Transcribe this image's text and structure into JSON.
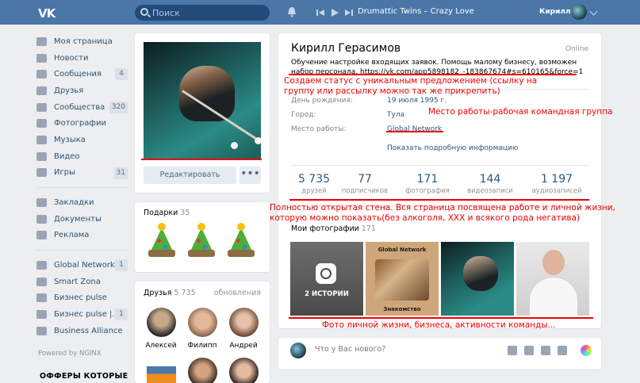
{
  "topbar": {
    "logo": "VK",
    "search_placeholder": "Поиск",
    "track": "Drumattic Twins – Crazy Love",
    "user_name": "Кирилл"
  },
  "menu": {
    "items": [
      {
        "label": "Моя страница",
        "count": "",
        "icon": "home-icon"
      },
      {
        "label": "Новости",
        "count": "",
        "icon": "news-icon"
      },
      {
        "label": "Сообщения",
        "count": "4",
        "icon": "messages-icon"
      },
      {
        "label": "Друзья",
        "count": "",
        "icon": "friends-icon"
      },
      {
        "label": "Сообщества",
        "count": "320",
        "icon": "communities-icon"
      },
      {
        "label": "Фотографии",
        "count": "",
        "icon": "photos-icon"
      },
      {
        "label": "Музыка",
        "count": "",
        "icon": "music-icon"
      },
      {
        "label": "Видео",
        "count": "",
        "icon": "video-icon"
      },
      {
        "label": "Игры",
        "count": "31",
        "icon": "games-icon"
      }
    ],
    "items2": [
      {
        "label": "Закладки",
        "icon": "bookmarks-icon"
      },
      {
        "label": "Документы",
        "icon": "documents-icon"
      },
      {
        "label": "Реклама",
        "icon": "ads-icon"
      }
    ],
    "items3": [
      {
        "label": "Global Network",
        "count": "1"
      },
      {
        "label": "Smart Zona",
        "count": ""
      },
      {
        "label": "Бизнес pulse",
        "count": ""
      },
      {
        "label": "Бизнес pulse |..",
        "count": "1"
      },
      {
        "label": "Business Alliance",
        "count": ""
      }
    ],
    "powered": "Powered by NGINX",
    "offers": "ОФФЕРЫ КОТОРЫЕ"
  },
  "profile_card": {
    "edit_label": "Редактировать",
    "more_label": "•••"
  },
  "gifts": {
    "title": "Подарки",
    "count": "35"
  },
  "friends": {
    "title": "Друзья",
    "count": "5 735",
    "updates": "обновления",
    "list": [
      {
        "name": "Алексей"
      },
      {
        "name": "Филипп"
      },
      {
        "name": "Андрей"
      }
    ]
  },
  "profile": {
    "name": "Кирилл Герасимов",
    "online": "Online",
    "status": "Обучение настройке входящих заявок. Помощь малому бизнесу, возможен набор персонала. https://vk.com/app5898182_-183867674#s=610165&force=1",
    "rows": [
      {
        "label": "День рождения:",
        "value": "19 июля 1995 г."
      },
      {
        "label": "Город:",
        "value": "Тула"
      },
      {
        "label": "Место работы:",
        "value": "Global Network"
      }
    ],
    "show_more": "Показать подробную информацию",
    "counters": [
      {
        "n": "5 735",
        "l": "друзей"
      },
      {
        "n": "77",
        "l": "подписчиков"
      },
      {
        "n": "171",
        "l": "фотография"
      },
      {
        "n": "144",
        "l": "видеозаписи"
      },
      {
        "n": "1 197",
        "l": "аудиозаписей"
      }
    ],
    "photos_title": "Мои фотографии",
    "photos_count": "171",
    "stories_label": "2 ИСТОРИИ",
    "ph2_top": "Global Network",
    "ph2_bottom": "Знакомство"
  },
  "post": {
    "placeholder": "Что у Вас нового?"
  },
  "annotations": {
    "status_note": "Создаем статус с уникальным предложением (ссылку на группу или рассылку можно так же прикрепить)",
    "work_note": "Место работы-рабочая командная группа",
    "wall_note": "Полностью открытая стена. Вся страница посвящена работе и личной жизни, которую можно показать(без алкоголя, ХХХ и всякого рода негатива)",
    "photos_note": "Фото личной жизни, бизнеса, активности команды..."
  },
  "colors": {
    "brand": "#4a76a8",
    "link": "#2a5885",
    "annotation": "#ee0000"
  }
}
